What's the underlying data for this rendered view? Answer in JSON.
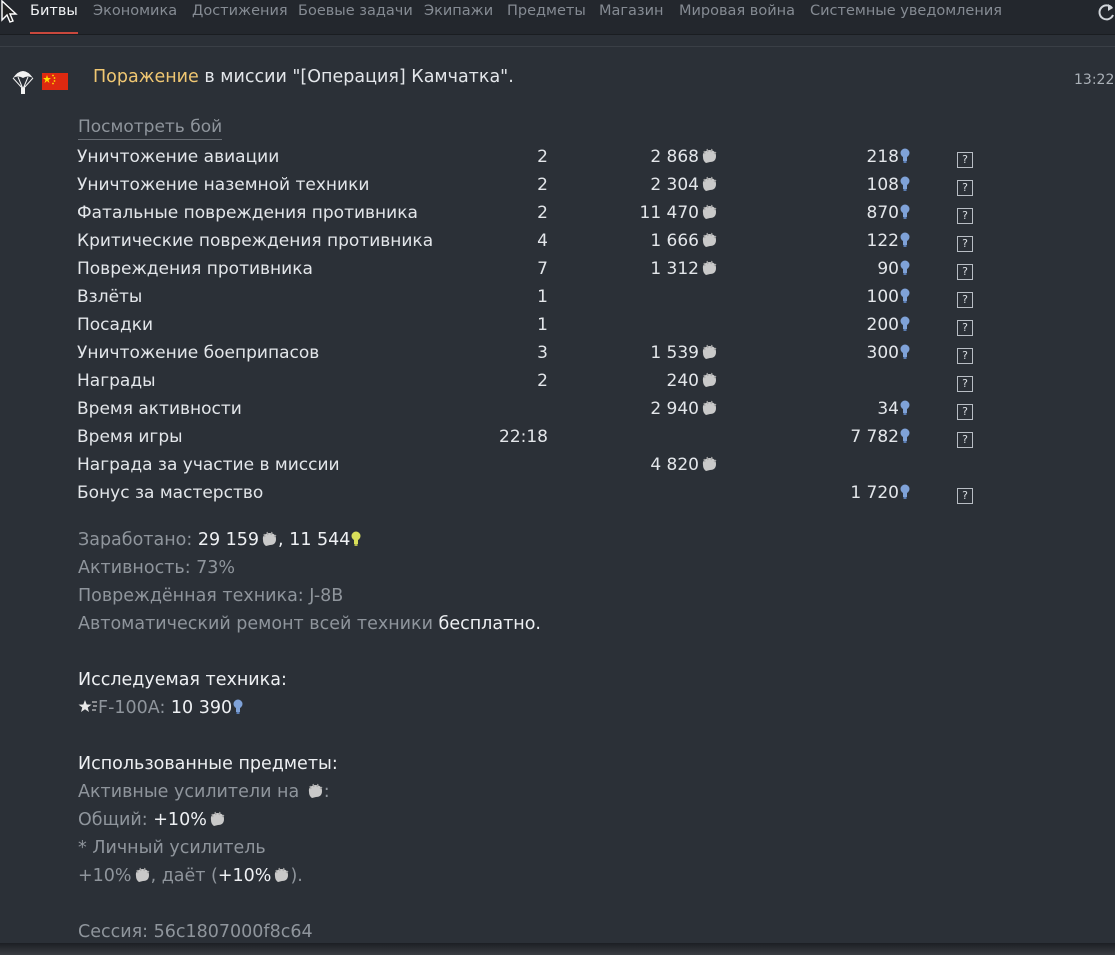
{
  "tabs": [
    {
      "label": "Битвы",
      "active": true
    },
    {
      "label": "Экономика"
    },
    {
      "label": "Достижения"
    },
    {
      "label": "Боевые задачи"
    },
    {
      "label": "Экипажи"
    },
    {
      "label": "Предметы"
    },
    {
      "label": "Магазин"
    },
    {
      "label": "Мировая война"
    },
    {
      "label": "Системные уведомления"
    }
  ],
  "message": {
    "result": "Поражение",
    "text": " в миссии \"[Операция] Камчатка\".",
    "time": "13:22"
  },
  "view_battle": "Посмотреть бой",
  "rows": [
    {
      "name": "Уничтожение авиации",
      "count": "2",
      "sl": "2 868",
      "rp": "218",
      "help": true
    },
    {
      "name": "Уничтожение наземной техники",
      "count": "2",
      "sl": "2 304",
      "rp": "108",
      "help": true
    },
    {
      "name": "Фатальные повреждения противника",
      "count": "2",
      "sl": "11 470",
      "rp": "870",
      "help": true
    },
    {
      "name": "Критические повреждения противника",
      "count": "4",
      "sl": "1 666",
      "rp": "122",
      "help": true
    },
    {
      "name": "Повреждения противника",
      "count": "7",
      "sl": "1 312",
      "rp": "90",
      "help": true
    },
    {
      "name": "Взлёты",
      "count": "1",
      "sl": "",
      "rp": "100",
      "help": true
    },
    {
      "name": "Посадки",
      "count": "1",
      "sl": "",
      "rp": "200",
      "help": true
    },
    {
      "name": "Уничтожение боеприпасов",
      "count": "3",
      "sl": "1 539",
      "rp": "300",
      "help": true
    },
    {
      "name": "Награды",
      "count": "2",
      "sl": "240",
      "rp": "",
      "help": true
    },
    {
      "name": "Время активности",
      "count": "",
      "sl": "2 940",
      "rp": "34",
      "help": true
    },
    {
      "name": "Время игры",
      "count": "22:18",
      "sl": "",
      "rp": "7 782",
      "help": true
    },
    {
      "name": "Награда за участие в миссии",
      "count": "",
      "sl": "4 820",
      "rp": "",
      "help": false
    },
    {
      "name": "Бонус за мастерство",
      "count": "",
      "sl": "",
      "rp": "1 720",
      "help": true
    }
  ],
  "help_glyph": "?",
  "summary": {
    "earned_label": "Заработано: ",
    "earned_sl": "29 159",
    "earned_sep": ", ",
    "earned_rp": "11 544",
    "activity": "Активность: 73%",
    "damaged_label": "Повреждённая техника: ",
    "damaged_value": "J-8B",
    "repair_label": "Автоматический ремонт всей техники ",
    "repair_value": "бесплатно."
  },
  "research": {
    "title": "Исследуемая техника:",
    "vehicle": "F-100A: ",
    "rp": "10 390"
  },
  "items": {
    "title": "Использованные предметы:",
    "active_label": "Активные усилители на ",
    "active_suffix": ":",
    "general_label": "Общий: ",
    "general_value": "+10%",
    "personal": "* Личный усилитель",
    "personal_value": "+10%",
    "gives_label": ", даёт (",
    "gives_value": "+10%",
    "gives_close": ")."
  },
  "session": "Сессия: 56c1807000f8c64",
  "colors": {
    "background": "#2b3037",
    "defeat": "#f0c772",
    "rp_icon": "#7fa2d8",
    "earned_bulb": "#d9e05a"
  },
  "icons": [
    "cursor-icon",
    "refresh-icon",
    "parachute-icon",
    "china-flag-icon",
    "lion-icon",
    "research-bulb-icon",
    "help-icon",
    "star-icon"
  ]
}
